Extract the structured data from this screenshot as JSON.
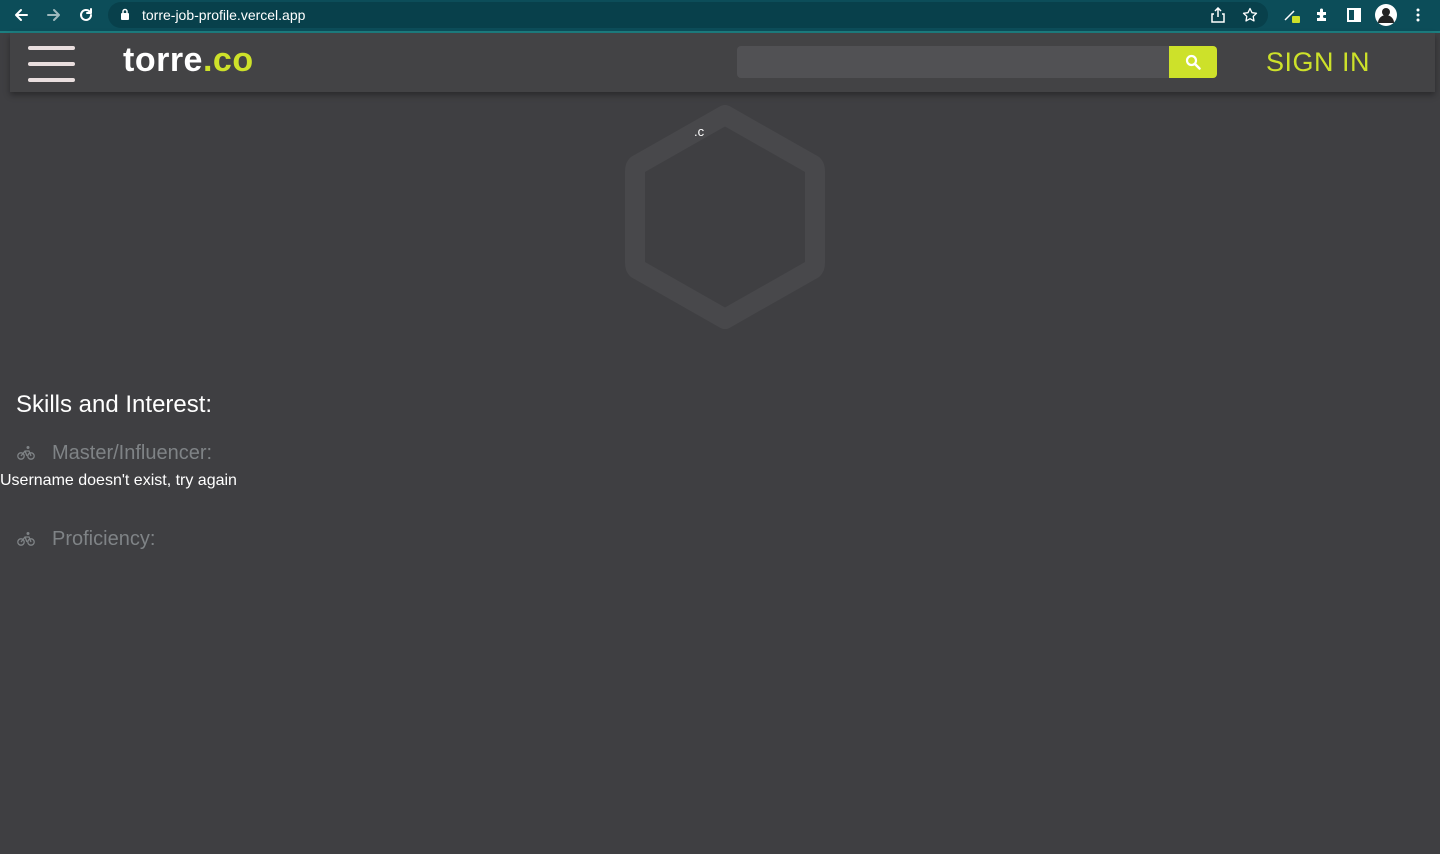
{
  "browser": {
    "url": "torre-job-profile.vercel.app",
    "icons": [
      "back-icon",
      "forward-icon",
      "reload-icon",
      "lock-icon",
      "share-icon",
      "bookmark-star-icon",
      "extension-pen-icon",
      "puzzle-extensions-icon",
      "side-panel-icon",
      "profile-avatar-icon",
      "more-menu-icon"
    ]
  },
  "header": {
    "logo_main": "torre",
    "logo_tld": ".co",
    "search": {
      "value": "",
      "placeholder": ""
    },
    "sign_in_label": "SIGN IN"
  },
  "profile": {
    "hex_label": ".‌c"
  },
  "content": {
    "skills_title": "Skills and Interest:",
    "master_label": "Master/Influencer:",
    "error_message": "Username doesn't exist, try again",
    "proficiency_label": "Proficiency:"
  },
  "colors": {
    "background": "#3f3f42",
    "header": "#434345",
    "accent": "#cde12a",
    "browser_bar": "#0c4d59",
    "muted_text": "#7f8386"
  }
}
